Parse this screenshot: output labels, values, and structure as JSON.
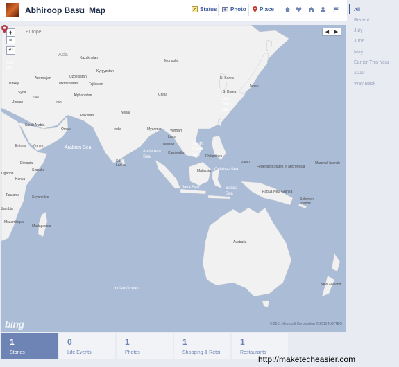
{
  "header": {
    "user_name": "Abhiroop Basu",
    "page_title": "Map",
    "actions": {
      "status": "Status",
      "photo": "Photo",
      "place": "Place"
    }
  },
  "timeline_nav": [
    "All",
    "Recent",
    "July",
    "June",
    "May",
    "Earlier This Year",
    "2010",
    "Way Back"
  ],
  "map": {
    "zoom_in": "+",
    "zoom_out": "−",
    "copyright": "© 2011 Microsoft Corporation   © 2010 NAVTEQ",
    "logo": "bing",
    "labels": {
      "europe": "Europe",
      "kazakhstan": "Kazakhstan",
      "mongolia": "Mongolia",
      "asia": "Asia",
      "black_sea": "Black\nSea",
      "uzbekistan": "Uzbekistan",
      "kyrgyzstan": "Kyrgyzstan",
      "turkey": "Turkey",
      "azerbaijan": "Azerbaijan",
      "turkmenistan": "Turkmenistan",
      "tajikistan": "Tajikistan",
      "syria": "Syria",
      "iraq": "Iraq",
      "iran": "Iran",
      "afghanistan": "Afghanistan",
      "china": "China",
      "n_korea": "N. Korea",
      "s_korea": "S. Korea",
      "japan": "Japan",
      "jordan": "Jordan",
      "pakistan": "Pakistan",
      "nepal": "Nepal",
      "east_china_sea": "East\nChina\nSea",
      "saudi_arabia": "Saudi Arabia",
      "oman": "Oman",
      "india": "India",
      "myanmar": "Myanmar",
      "vietnam": "Vietnam",
      "laos": "Laos",
      "eritrea": "Eritrea",
      "yemen": "Yemen",
      "arabian_sea": "Arabian Sea",
      "andaman_sea": "Andaman\nSea",
      "thailand": "Thailand",
      "cambodia": "Cambodia",
      "south_china_sea": "South\nChina\nSea",
      "philippines": "Philippines",
      "ethiopia": "Ethiopia",
      "sri_lanka": "Sri\nLanka",
      "palau": "Palau",
      "fsm": "Federated States of Micronesia",
      "marshall_islands": "Marshall Islands",
      "somalia": "Somalia",
      "malaysia": "Malaysia",
      "kenya": "Kenya",
      "uganda": "Uganda",
      "celebes_sea": "Celebes Sea",
      "tanzania": "Tanzania",
      "seychelles": "Seychelles",
      "banda_sea": "Banda\nSea",
      "java_sea": "Java Sea",
      "papua_new_guinea": "Papua New Guinea",
      "solomon_islands": "Solomon\nIslands",
      "zambia": "Zambia",
      "mozambique": "Mozambique",
      "madagascar": "Madagascar",
      "australia": "Australia",
      "indian_ocean": "Indian Ocean",
      "new_zealand": "New Zealand"
    }
  },
  "stats": [
    {
      "value": "1",
      "label": "Stories"
    },
    {
      "value": "0",
      "label": "Life Events"
    },
    {
      "value": "1",
      "label": "Photos"
    },
    {
      "value": "1",
      "label": "Shopping & Retail"
    },
    {
      "value": "1",
      "label": "Restaurants"
    }
  ],
  "watermark": "http://maketecheasier.com",
  "colors": {
    "accent": "#3b5998",
    "ocean": "#abbcd7",
    "land": "#f1f1f1",
    "active_stat": "#6d84b4"
  }
}
